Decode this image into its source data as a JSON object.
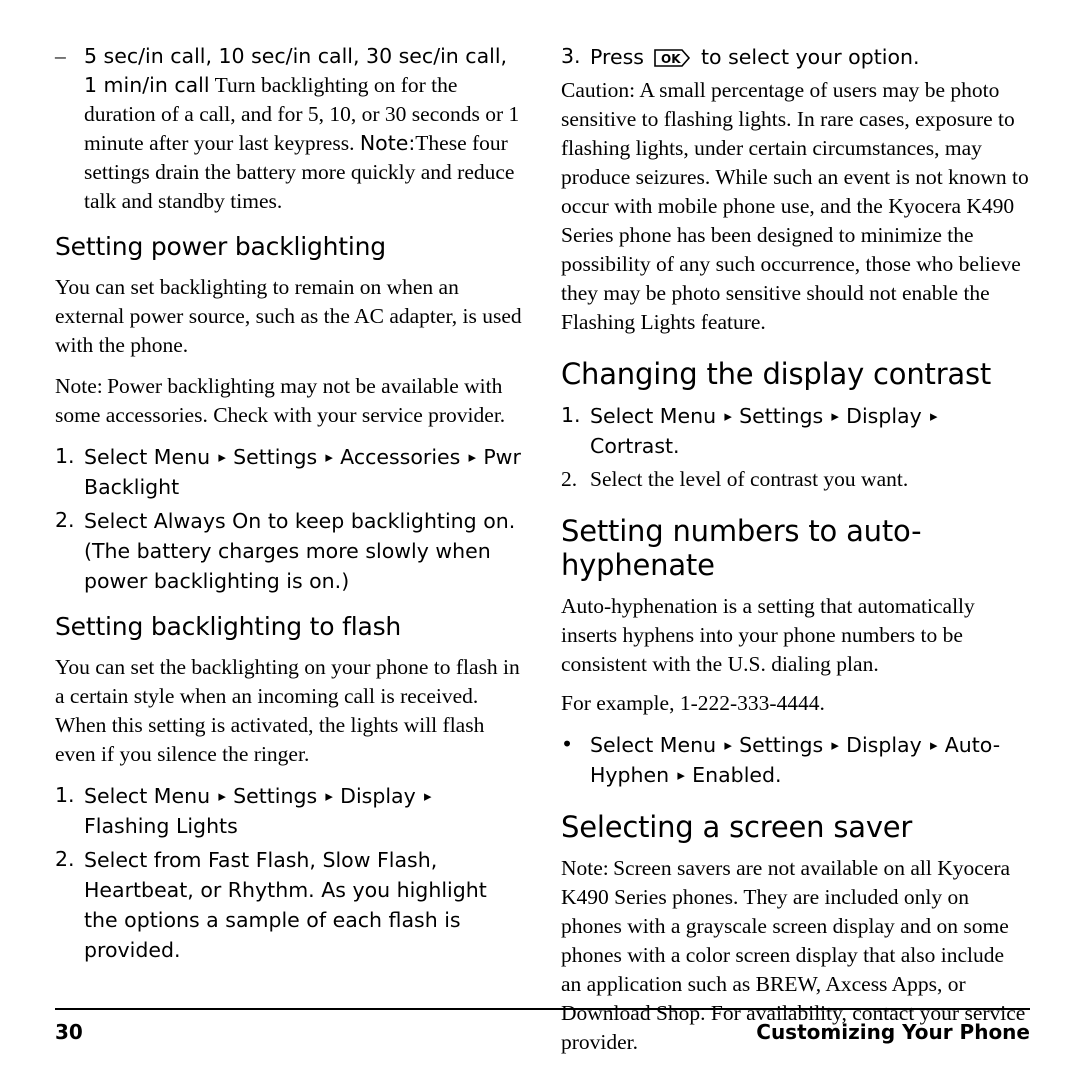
{
  "document": {
    "footer": {
      "page_number": "30",
      "chapter": "Customizing Your Phone"
    }
  },
  "left_column": {
    "dash_item": {
      "marker": "–",
      "text_a": "5 sec/in call, 10 sec/in call, 30 sec/in call, 1 min/in call",
      "text_b": "Turn backlighting on for the duration of a call, and for 5, 10, or 30 seconds or 1 minute after your last keypress.",
      "note_label": "Note:",
      "note_text": "These four settings drain the battery more quickly and reduce talk and standby times."
    },
    "heading_power_backlighting": "Setting power backlighting",
    "para_power_1": "You can set backlighting to remain on when an external power source, such as the AC adapter, is used with the phone.",
    "note_power_label": "Note:",
    "note_power_text": "Power backlighting may not be available with some accessories. Check with your service provider.",
    "steps_power": [
      {
        "marker": "1.",
        "lead": "Select",
        "path": [
          "Menu",
          "Settings",
          "Accessories",
          "Pwr Backlight"
        ]
      },
      {
        "marker": "2.",
        "pre": "Select",
        "value": "Always On",
        "post": "to keep backlighting on. (The battery charges more slowly when power backlighting is on.)"
      }
    ],
    "heading_flash": "Setting backlighting to flash",
    "para_flash": "You can set the backlighting on your phone to flash in a certain style when an incoming call is received. When this setting is activated, the lights will flash even if you silence the ringer.",
    "steps_flash": [
      {
        "marker": "1.",
        "lead": "Select",
        "path": [
          "Menu",
          "Settings",
          "Display",
          "Flashing Lights"
        ]
      },
      {
        "marker": "2.",
        "pre": "Select from",
        "values": "Fast Flash, Slow Flash, Heartbeat, or Rhythm.",
        "post": "As you highlight the options a sample of each flash is provided."
      }
    ]
  },
  "right_column": {
    "step_press": {
      "marker": "3.",
      "pre": "Press",
      "icon": "ok-key-icon",
      "post": "to select your option."
    },
    "caution_label": "Caution:",
    "caution_text": "A small percentage of users may be photo sensitive to flashing lights. In rare cases, exposure to flashing lights, under certain circumstances, may produce seizures. While such an event is not known to occur with mobile phone use, and the Kyocera K490 Series phone has been designed to minimize the possibility of any such occurrence, those who believe they may be photo sensitive should not enable the Flashing Lights feature.",
    "heading_contrast": "Changing the display contrast",
    "steps_contrast": [
      {
        "marker": "1.",
        "lead": "Select",
        "path": [
          "Menu",
          "Settings",
          "Display",
          "Cortrast."
        ]
      },
      {
        "marker": "2.",
        "text": "Select the level of contrast you want."
      }
    ],
    "heading_hyphenate": "Setting numbers to auto-hyphenate",
    "para_hyphenate": "Auto-hyphenation is a setting that automatically inserts hyphens into your phone numbers to be consistent with the U.S. dialing plan.",
    "para_example": "For example, 1-222-333-4444.",
    "bullet_hyphen": {
      "marker": "•",
      "lead": "Select",
      "path": [
        "Menu",
        "Settings",
        "Display",
        "Auto-Hyphen",
        "Enabled."
      ]
    },
    "heading_screensaver": "Selecting a screen saver",
    "note_screensaver_label": "Note:",
    "note_screensaver_text": "Screen savers are not available on all Kyocera K490 Series phones. They are included only on phones with a grayscale screen display and on some phones with a color screen display that also include an application such as BREW, Axcess Apps, or Download Shop. For availability, contact your service provider."
  }
}
